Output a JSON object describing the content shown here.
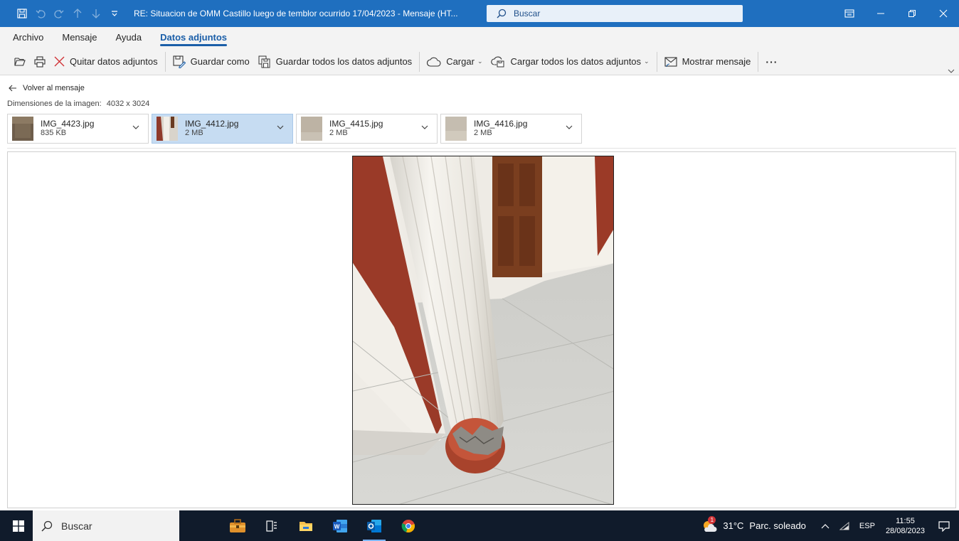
{
  "titlebar": {
    "title": "RE: Situacion de OMM Castillo luego de temblor ocurrido 17/04/2023  -  Mensaje (HT...",
    "search_placeholder": "Buscar",
    "color": "#1f6fbf"
  },
  "menu": {
    "tabs": [
      {
        "label": "Archivo"
      },
      {
        "label": "Mensaje"
      },
      {
        "label": "Ayuda"
      },
      {
        "label": "Datos adjuntos"
      }
    ],
    "active_tab": "Datos adjuntos"
  },
  "ribbon": {
    "quitar": "Quitar datos adjuntos",
    "guardar_como": "Guardar como",
    "guardar_todos": "Guardar todos los datos adjuntos",
    "cargar": "Cargar",
    "cargar_todos": "Cargar todos los datos adjuntos",
    "mostrar_mensaje": "Mostrar mensaje",
    "more": "···"
  },
  "viewer": {
    "back_label": "Volver al mensaje",
    "dimensions_label": "Dimensiones de la imagen:",
    "dimensions_value": "4032 x 3024"
  },
  "attachments": [
    {
      "name": "IMG_4423.jpg",
      "size": "835 KB",
      "selected": false
    },
    {
      "name": "IMG_4412.jpg",
      "size": "2 MB",
      "selected": true
    },
    {
      "name": "IMG_4415.jpg",
      "size": "2 MB",
      "selected": false
    },
    {
      "name": "IMG_4416.jpg",
      "size": "2 MB",
      "selected": false
    }
  ],
  "taskbar": {
    "search_label": "Buscar",
    "weather_temp": "31°C",
    "weather_desc": "Parc. soleado",
    "language": "ESP",
    "time": "11:55",
    "date": "28/08/2023",
    "weather_badge": "1"
  }
}
